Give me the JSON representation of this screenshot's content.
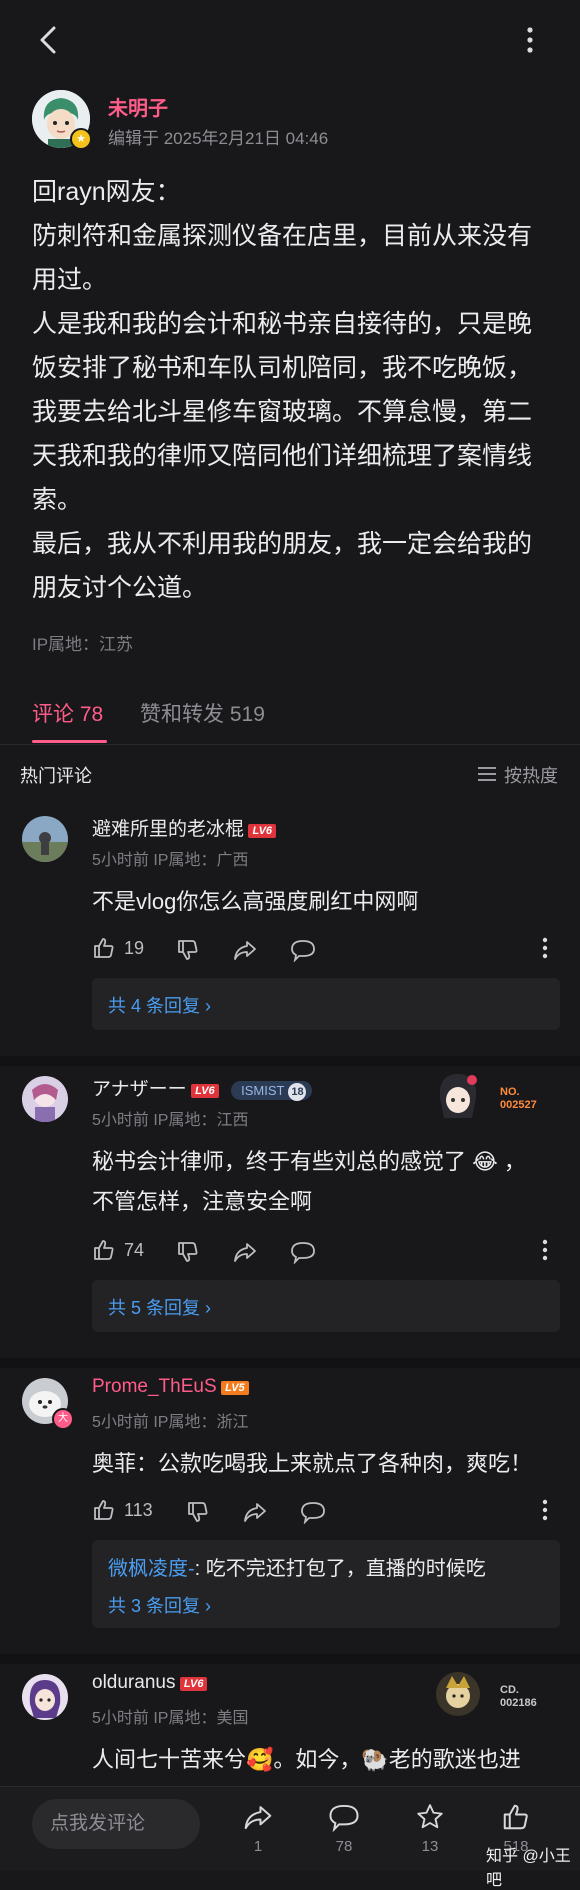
{
  "author": {
    "name": "未明子",
    "edit_time": "编辑于 2025年2月21日 04:46"
  },
  "post": {
    "paragraphs": [
      "回rayn网友：",
      "防刺符和金属探测仪备在店里，目前从来没有用过。",
      "人是我和我的会计和秘书亲自接待的，只是晚饭安排了秘书和车队司机陪同，我不吃晚饭，我要去给北斗星修车窗玻璃。不算怠慢，第二天我和我的律师又陪同他们详细梳理了案情线索。",
      "最后，我从不利用我的朋友，我一定会给我的朋友讨个公道。"
    ],
    "ip": "IP属地：江苏"
  },
  "tabs": {
    "comments": "评论 78",
    "likes": "赞和转发 519"
  },
  "section": {
    "hot_label": "热门评论",
    "sort_label": "按热度"
  },
  "comments": [
    {
      "name": "避难所里的老冰棍",
      "level": "LV6",
      "meta": "5小时前 IP属地：广西",
      "text": "不是vlog你怎么高强度刷红中网啊",
      "likes": "19",
      "reply_summary": "共 4 条回复 ›"
    },
    {
      "name": "アナザーー",
      "level": "LV6",
      "badge": "ISMIST",
      "badge_num": "18",
      "medal_label": "NO.",
      "medal_num": "002527",
      "meta": "5小时前 IP属地：江西",
      "text_lines": [
        "秘书会计律师，终于有些刘总的感觉了 😂 ，",
        "不管怎样，注意安全啊"
      ],
      "likes": "74",
      "reply_summary": "共 5 条回复 ›"
    },
    {
      "name": "Prome_ThEuS",
      "level": "LV5",
      "avatar_badge": "大",
      "meta": "5小时前 IP属地：浙江",
      "text": "奥菲：公款吃喝我上来就点了各种肉，爽吃！",
      "likes": "113",
      "reply_user": "微枫凌度-",
      "reply_text": ": 吃不完还打包了，直播的时候吃",
      "reply_summary": "共 3 条回复 ›"
    },
    {
      "name": "olduranus",
      "level": "LV6",
      "medal_label": "CD.",
      "medal_num": "002186",
      "meta": "5小时前 IP属地：美国",
      "text": "人间七十苦来兮🥰。如今，🐏老的歌迷也进"
    }
  ],
  "bottom": {
    "input_placeholder": "点我发评论",
    "share_count": "1",
    "comment_count": "78",
    "star_count": "13",
    "like_count": "518"
  },
  "watermark": "知乎 @小王吧",
  "colors": {
    "background": "#18181a",
    "accent_pink": "#ff5c8a",
    "link_blue": "#4a9df0",
    "level_red": "#e0343c",
    "level_orange": "#f47b1e"
  }
}
